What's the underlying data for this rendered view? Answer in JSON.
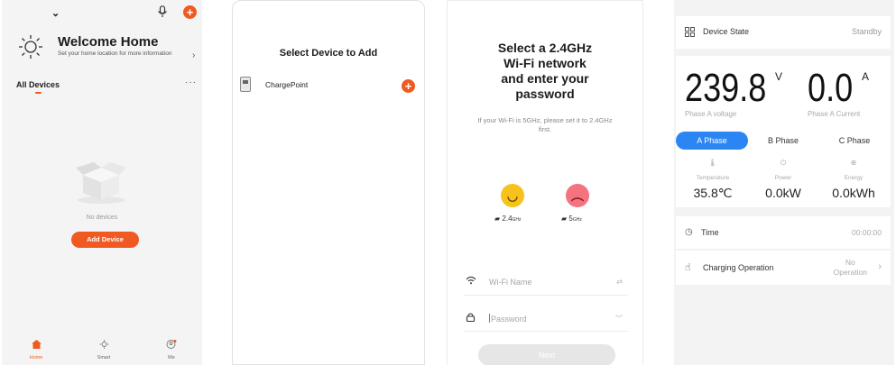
{
  "home": {
    "welcome_title": "Welcome Home",
    "welcome_subtitle": "Set your home location for more information",
    "all_devices": "All Devices",
    "more": "···",
    "empty_text": "No devices",
    "add_device": "Add Device",
    "tabs": [
      {
        "label": "Home",
        "icon": "house-icon"
      },
      {
        "label": "Smart",
        "icon": "sun-icon"
      },
      {
        "label": "Me",
        "icon": "user-icon"
      }
    ],
    "accent": "#f05a22"
  },
  "select_device": {
    "title": "Select Device to Add",
    "device_name": "ChargePoint"
  },
  "wifi": {
    "title_lines": [
      "Select a 2.4GHz",
      "Wi-Fi network",
      "and enter your",
      "password"
    ],
    "subtitle": "If your Wi-Fi is 5GHz, please set it to 2.4GHz first.",
    "band_ok_num": "2.4",
    "band_ok_unit": "GHz",
    "band_bad_num": "5",
    "band_bad_unit": "GHz",
    "wifi_placeholder": "Wi-Fi Name",
    "password_placeholder": "Password",
    "next": "Next"
  },
  "device_state": {
    "label": "Device State",
    "value": "Standby",
    "voltage": "239.8",
    "voltage_unit": "V",
    "voltage_label": "Phase A voltage",
    "current": "0.0",
    "current_unit": "A",
    "current_label": "Phase A Current",
    "phases": [
      "A Phase",
      "B Phase",
      "C Phase"
    ],
    "active_phase_color": "#2b86f3",
    "metrics": [
      {
        "label": "Temperature",
        "value": "35.8℃"
      },
      {
        "label": "Power",
        "value": "0.0kW"
      },
      {
        "label": "Energy",
        "value": "0.0kWh"
      }
    ],
    "time_label": "Time",
    "time_value": "00:00:00",
    "charging_label": "Charging Operation",
    "charging_value_line1": "No",
    "charging_value_line2": "Operation"
  }
}
